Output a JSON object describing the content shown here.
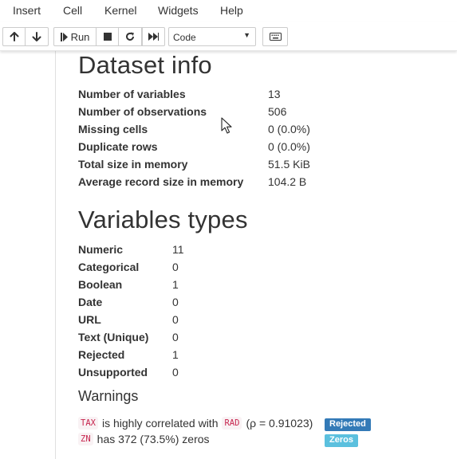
{
  "menu": {
    "items": [
      {
        "label": "Insert"
      },
      {
        "label": "Cell"
      },
      {
        "label": "Kernel"
      },
      {
        "label": "Widgets"
      },
      {
        "label": "Help"
      }
    ]
  },
  "toolbar": {
    "buttons": [
      {
        "name": "move-up",
        "icon": "arrow-up-icon"
      },
      {
        "name": "move-down",
        "icon": "arrow-down-icon"
      },
      {
        "name": "run",
        "icon": "step-forward-icon",
        "label": "Run"
      },
      {
        "name": "interrupt",
        "icon": "stop-icon"
      },
      {
        "name": "restart",
        "icon": "restart-icon"
      },
      {
        "name": "restart-run-all",
        "icon": "fast-forward-icon"
      },
      {
        "name": "command-palette",
        "icon": "keyboard-icon"
      }
    ],
    "cell_type": {
      "selected": "Code"
    }
  },
  "dataset_info": {
    "title": "Dataset info",
    "rows": [
      {
        "label": "Number of variables",
        "value": "13"
      },
      {
        "label": "Number of observations",
        "value": "506"
      },
      {
        "label": "Missing cells",
        "value": "0 (0.0%)"
      },
      {
        "label": "Duplicate rows",
        "value": "0 (0.0%)"
      },
      {
        "label": "Total size in memory",
        "value": "51.5 KiB"
      },
      {
        "label": "Average record size in memory",
        "value": "104.2 B"
      }
    ]
  },
  "variable_types": {
    "title": "Variables types",
    "rows": [
      {
        "label": "Numeric",
        "value": "11"
      },
      {
        "label": "Categorical",
        "value": "0"
      },
      {
        "label": "Boolean",
        "value": "1"
      },
      {
        "label": "Date",
        "value": "0"
      },
      {
        "label": "URL",
        "value": "0"
      },
      {
        "label": "Text (Unique)",
        "value": "0"
      },
      {
        "label": "Rejected",
        "value": "1"
      },
      {
        "label": "Unsupported",
        "value": "0"
      }
    ]
  },
  "warnings": {
    "title": "Warnings",
    "items": [
      {
        "var1": "TAX",
        "text1": "is highly correlated with",
        "var2": "RAD",
        "text2": "(ρ = 0.91023)",
        "badge": "Rejected",
        "badge_color": "#337ab7"
      },
      {
        "var1": "ZN",
        "text1": "has 372 (73.5%) zeros",
        "badge": "Zeros",
        "badge_color": "#5bc0de"
      }
    ]
  },
  "colors": {
    "code_text": "#c7254e",
    "code_bg": "#f9f2f4",
    "rejected_badge": "#337ab7",
    "zeros_badge": "#5bc0de"
  }
}
